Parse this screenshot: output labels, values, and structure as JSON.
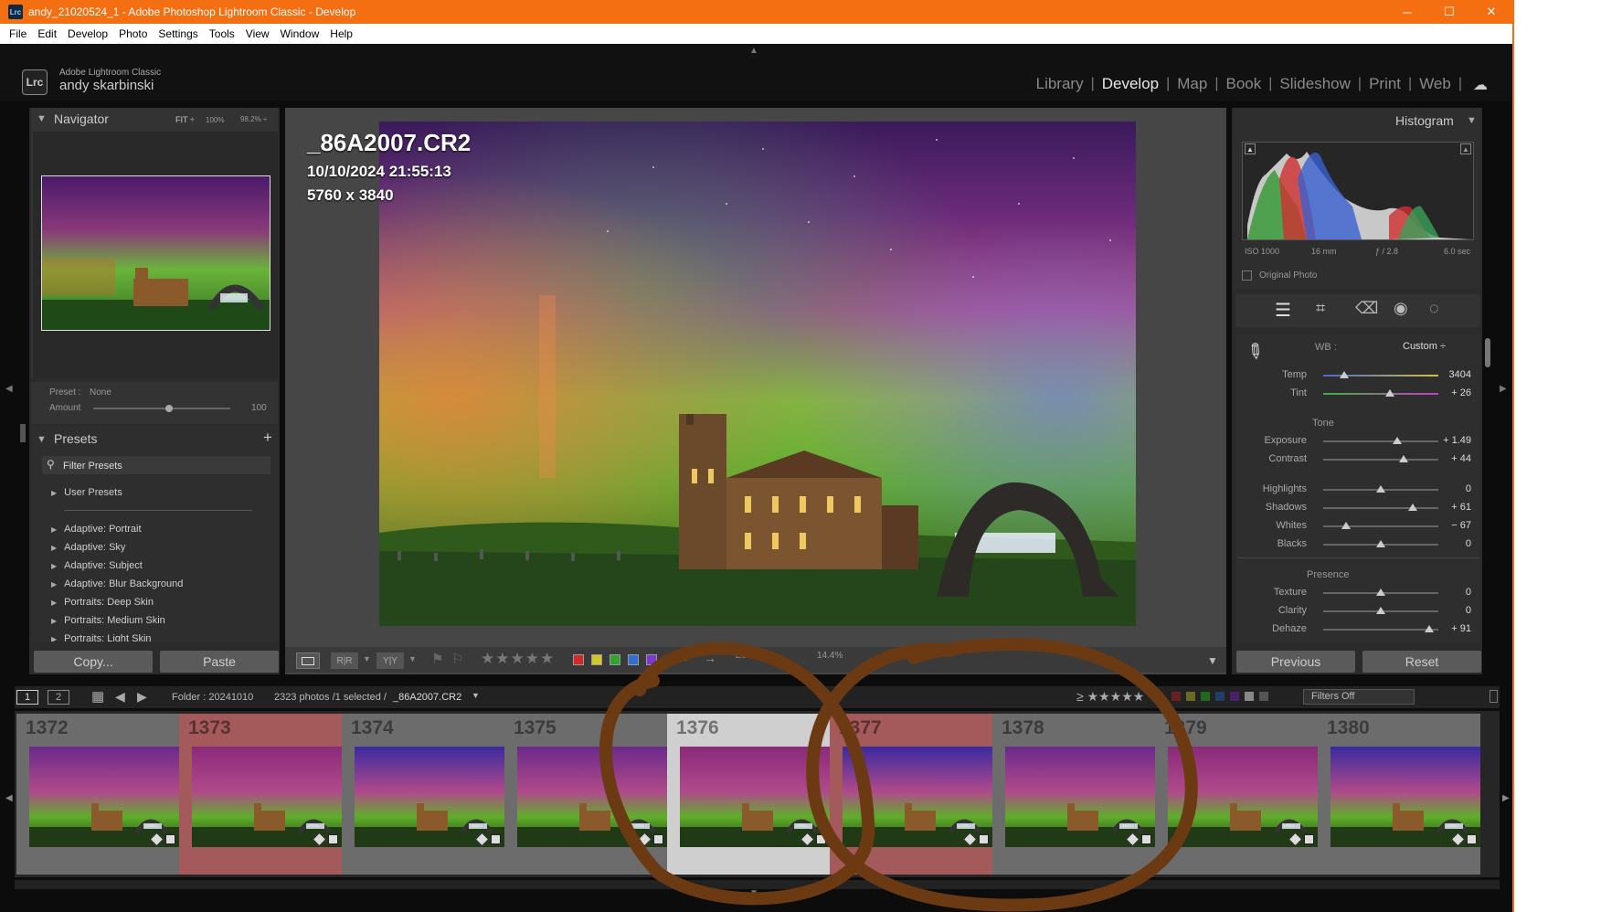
{
  "window": {
    "title": "andy_21020524_1 - Adobe Photoshop Lightroom Classic - Develop",
    "minimize": "─",
    "maximize": "☐",
    "close": "✕"
  },
  "menu": [
    "File",
    "Edit",
    "Develop",
    "Photo",
    "Settings",
    "Tools",
    "View",
    "Window",
    "Help"
  ],
  "identity": {
    "logo": "Lrc",
    "app": "Adobe Lightroom Classic",
    "user": "andy skarbinski"
  },
  "modules": [
    "Library",
    "Develop",
    "Map",
    "Book",
    "Slideshow",
    "Print",
    "Web"
  ],
  "active_module": "Develop",
  "navigator": {
    "title": "Navigator",
    "fit": "FIT ÷",
    "z100": "100%",
    "z98": "98.2% ÷"
  },
  "preset_amount": {
    "preset_label": "Preset :",
    "preset_value": "None",
    "amount_label": "Amount",
    "amount_value": "100",
    "amount_level": 0.55
  },
  "presets": {
    "title": "Presets",
    "filter": "Filter Presets",
    "items": [
      "User Presets",
      "Adaptive: Portrait",
      "Adaptive: Sky",
      "Adaptive: Subject",
      "Adaptive: Blur Background",
      "Portraits: Deep Skin",
      "Portraits: Medium Skin",
      "Portraits: Light Skin"
    ]
  },
  "left_buttons": {
    "copy": "Copy...",
    "paste": "Paste"
  },
  "photo_info": {
    "filename": "_86A2007.CR2",
    "datetime": "10/10/2024 21:55:13",
    "dimensions": "5760 x 3840"
  },
  "toolbar": {
    "zoom_label": "Zoom",
    "zoom_value": "14.4%",
    "rating": "★★★★★",
    "compare1": "R|R",
    "compare2": "Y|Y"
  },
  "color_labels": [
    "#d02a2a",
    "#d2c928",
    "#2fa52f",
    "#2f70d0",
    "#7a3ad0"
  ],
  "histogram": {
    "title": "Histogram",
    "iso": "ISO 1000",
    "focal": "16 mm",
    "aperture": "ƒ / 2.8",
    "shutter": "6.0 sec",
    "original": "Original Photo"
  },
  "wb": {
    "label": "WB :",
    "value": "Custom ÷"
  },
  "basic": {
    "tone_title": "Tone",
    "presence_title": "Presence",
    "wb_rows": [
      {
        "label": "Temp",
        "value": "3404",
        "level": 0.18
      },
      {
        "label": "Tint",
        "value": "+ 26",
        "level": 0.58
      }
    ],
    "tone_rows": [
      {
        "label": "Exposure",
        "value": "+ 1.49",
        "level": 0.64
      },
      {
        "label": "Contrast",
        "value": "+ 44",
        "level": 0.7
      },
      {
        "label": "Highlights",
        "value": "0",
        "level": 0.5
      },
      {
        "label": "Shadows",
        "value": "+ 61",
        "level": 0.78
      },
      {
        "label": "Whites",
        "value": "− 67",
        "level": 0.2
      },
      {
        "label": "Blacks",
        "value": "0",
        "level": 0.5
      }
    ],
    "presence_rows": [
      {
        "label": "Texture",
        "value": "0",
        "level": 0.5
      },
      {
        "label": "Clarity",
        "value": "0",
        "level": 0.5
      },
      {
        "label": "Dehaze",
        "value": "+ 91",
        "level": 0.92
      }
    ]
  },
  "right_buttons": {
    "previous": "Previous",
    "reset": "Reset"
  },
  "filmbar": {
    "page1": "1",
    "page2": "2",
    "folder": "Folder : 20241010",
    "count": "2323 photos /1 selected /",
    "selected_file": "_86A2007.CR2",
    "filters": "Filters Off"
  },
  "filmstrip": [
    {
      "num": "1372",
      "style": ""
    },
    {
      "num": "1373",
      "style": "red"
    },
    {
      "num": "1374",
      "style": ""
    },
    {
      "num": "1375",
      "style": ""
    },
    {
      "num": "1376",
      "style": "sel"
    },
    {
      "num": "1377",
      "style": "red"
    },
    {
      "num": "1378",
      "style": ""
    },
    {
      "num": "1379",
      "style": ""
    },
    {
      "num": "1380",
      "style": ""
    }
  ]
}
